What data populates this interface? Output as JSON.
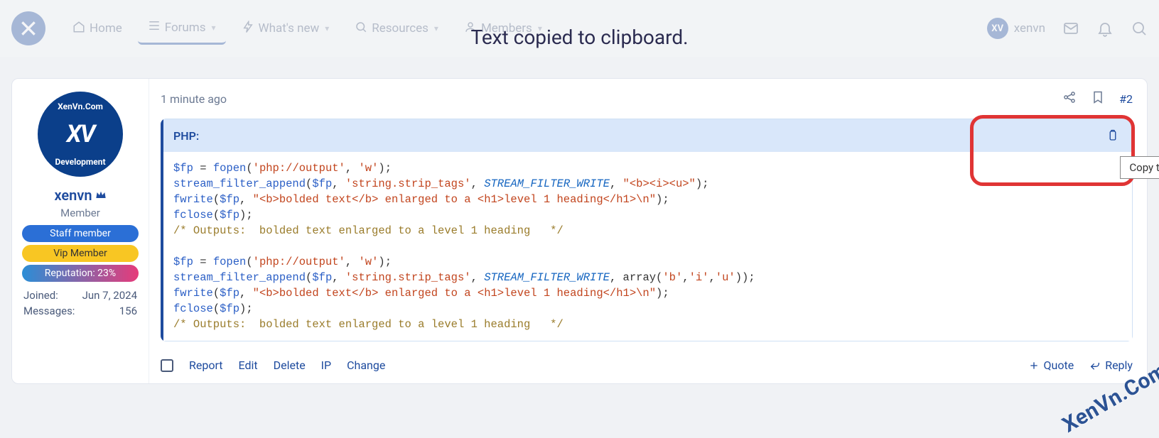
{
  "nav": {
    "home": "Home",
    "forums": "Forums",
    "whatsnew": "What's new",
    "resources": "Resources",
    "members": "Members",
    "user": "xenvn"
  },
  "toast": "Text copied to clipboard.",
  "post": {
    "time": "1 minute ago",
    "number": "#2"
  },
  "user": {
    "avatar_top": "XenVn.Com",
    "avatar_bottom": "Development",
    "avatar_center": "XV",
    "name": "xenvn",
    "title": "Member",
    "badges": {
      "staff": "Staff member",
      "vip": "Vip Member",
      "rep": "Reputation: 23%"
    },
    "stats": {
      "joined_label": "Joined:",
      "joined_value": "Jun 7, 2024",
      "messages_label": "Messages:",
      "messages_value": "156"
    }
  },
  "code": {
    "title": "PHP:",
    "tooltip": "Copy to clipboard",
    "lines": {
      "l1_var": "$fp",
      "l1_eq": " = ",
      "l1_fn": "fopen",
      "l1_p1": "(",
      "l1_s1": "'php://output'",
      "l1_c": ", ",
      "l1_s2": "'w'",
      "l1_p2": ");",
      "l2_fn": "stream_filter_append",
      "l2_p1": "(",
      "l2_var": "$fp",
      "l2_c1": ", ",
      "l2_s1": "'string.strip_tags'",
      "l2_c2": ", ",
      "l2_const": "STREAM_FILTER_WRITE",
      "l2_c3": ", ",
      "l2_s2": "\"<b><i><u>\"",
      "l2_p2": ");",
      "l3_fn": "fwrite",
      "l3_p1": "(",
      "l3_var": "$fp",
      "l3_c1": ", ",
      "l3_s1": "\"<b>bolded text</b> enlarged to a <h1>level 1 heading</h1>\\n\"",
      "l3_p2": ");",
      "l4_fn": "fclose",
      "l4_p1": "(",
      "l4_var": "$fp",
      "l4_p2": ");",
      "l5_comment": "/* Outputs:  bolded text enlarged to a level 1 heading   */",
      "l7_var": "$fp",
      "l7_eq": " = ",
      "l7_fn": "fopen",
      "l7_p1": "(",
      "l7_s1": "'php://output'",
      "l7_c": ", ",
      "l7_s2": "'w'",
      "l7_p2": ");",
      "l8_fn": "stream_filter_append",
      "l8_p1": "(",
      "l8_var": "$fp",
      "l8_c1": ", ",
      "l8_s1": "'string.strip_tags'",
      "l8_c2": ", ",
      "l8_const": "STREAM_FILTER_WRITE",
      "l8_c3": ", array(",
      "l8_sa": "'b'",
      "l8_ca": ",",
      "l8_sb": "'i'",
      "l8_cb": ",",
      "l8_sc": "'u'",
      "l8_p2": "));",
      "l9_fn": "fwrite",
      "l9_p1": "(",
      "l9_var": "$fp",
      "l9_c1": ", ",
      "l9_s1": "\"<b>bolded text</b> enlarged to a <h1>level 1 heading</h1>\\n\"",
      "l9_p2": ");",
      "l10_fn": "fclose",
      "l10_p1": "(",
      "l10_var": "$fp",
      "l10_p2": ");",
      "l11_comment": "/* Outputs:  bolded text enlarged to a level 1 heading   */"
    }
  },
  "footer": {
    "report": "Report",
    "edit": "Edit",
    "delete": "Delete",
    "ip": "IP",
    "change": "Change",
    "quote": "Quote",
    "reply": "Reply"
  },
  "watermark": "XenVn.Com"
}
